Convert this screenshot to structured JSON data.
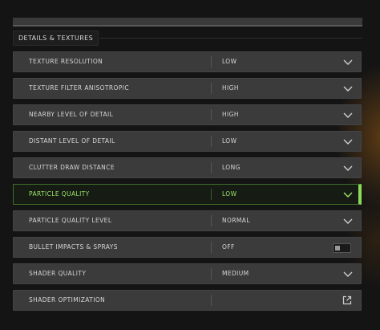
{
  "section": {
    "title": "DETAILS & TEXTURES"
  },
  "settings": [
    {
      "label": "TEXTURE RESOLUTION",
      "value": "LOW",
      "control": "chevron-down-icon"
    },
    {
      "label": "TEXTURE FILTER ANISOTROPIC",
      "value": "HIGH",
      "control": "chevron-down-icon"
    },
    {
      "label": "NEARBY LEVEL OF DETAIL",
      "value": "HIGH",
      "control": "chevron-down-icon"
    },
    {
      "label": "DISTANT LEVEL OF DETAIL",
      "value": "LOW",
      "control": "chevron-down-icon"
    },
    {
      "label": "CLUTTER DRAW DISTANCE",
      "value": "LONG",
      "control": "chevron-down-icon"
    },
    {
      "label": "PARTICLE QUALITY",
      "value": "LOW",
      "control": "chevron-down-icon",
      "active": true
    },
    {
      "label": "PARTICLE QUALITY LEVEL",
      "value": "NORMAL",
      "control": "chevron-down-icon"
    },
    {
      "label": "BULLET IMPACTS & SPRAYS",
      "value": "OFF",
      "control": "toggle-switch"
    },
    {
      "label": "SHADER QUALITY",
      "value": "MEDIUM",
      "control": "chevron-down-icon"
    },
    {
      "label": "SHADER OPTIMIZATION",
      "value": "",
      "control": "external-link-icon"
    }
  ],
  "colors": {
    "accent": "#8bdc5a",
    "row_bg": "#3b3b3b",
    "text": "#d6d6d6"
  }
}
